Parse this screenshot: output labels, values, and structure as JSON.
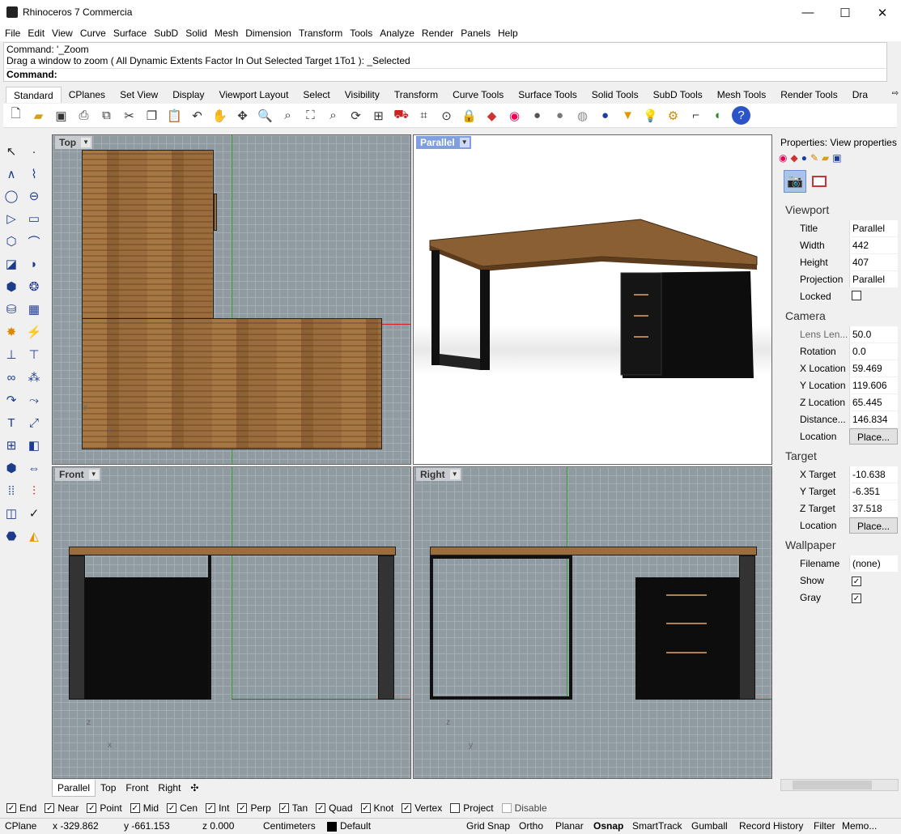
{
  "window": {
    "title": "Rhinoceros 7 Commercia"
  },
  "menu": [
    "File",
    "Edit",
    "View",
    "Curve",
    "Surface",
    "SubD",
    "Solid",
    "Mesh",
    "Dimension",
    "Transform",
    "Tools",
    "Analyze",
    "Render",
    "Panels",
    "Help"
  ],
  "command": {
    "history1": "Command: '_Zoom",
    "history2": "Drag a window to zoom ( All  Dynamic  Extents  Factor  In  Out  Selected  Target  1To1 ): _Selected",
    "prompt": "Command:"
  },
  "toolbar_tabs": [
    "Standard",
    "CPlanes",
    "Set View",
    "Display",
    "Viewport Layout",
    "Select",
    "Visibility",
    "Transform",
    "Curve Tools",
    "Surface Tools",
    "Solid Tools",
    "SubD Tools",
    "Mesh Tools",
    "Render Tools",
    "Dra"
  ],
  "toolbar_icons": [
    "new-icon",
    "open-icon",
    "save-icon",
    "print-icon",
    "import-icon",
    "cut-icon",
    "copy-icon",
    "paste-icon",
    "undo-icon",
    "pan-icon",
    "move-icon",
    "zoom-icon",
    "zoom-window-icon",
    "zoom-extents-icon",
    "zoom-selected-icon",
    "rotate-view-icon",
    "four-view-icon",
    "car-icon",
    "grid-icon",
    "circle-point-icon",
    "lock-icon",
    "layers-icon",
    "color-wheel-icon",
    "sphere-icon",
    "shaded-sphere-icon",
    "render-sphere-icon",
    "blue-sphere-icon",
    "light-icon",
    "bulb-icon",
    "gear-icon",
    "snap-icon",
    "globe-icon",
    "help-icon"
  ],
  "viewports": {
    "top": {
      "label": "Top"
    },
    "parallel": {
      "label": "Parallel"
    },
    "front": {
      "label": "Front"
    },
    "right": {
      "label": "Right"
    }
  },
  "axes": {
    "x": "x",
    "y": "y",
    "z": "z"
  },
  "viewport_tabs": [
    "Parallel",
    "Top",
    "Front",
    "Right"
  ],
  "properties": {
    "header": "Properties: View properties",
    "viewport_section": "Viewport",
    "title_label": "Title",
    "title_value": "Parallel",
    "width_label": "Width",
    "width_value": "442",
    "height_label": "Height",
    "height_value": "407",
    "projection_label": "Projection",
    "projection_value": "Parallel",
    "locked_label": "Locked",
    "camera_section": "Camera",
    "lens_label": "Lens Len...",
    "lens_value": "50.0",
    "rotation_label": "Rotation",
    "rotation_value": "0.0",
    "xloc_label": "X Location",
    "xloc_value": "59.469",
    "yloc_label": "Y Location",
    "yloc_value": "119.606",
    "zloc_label": "Z Location",
    "zloc_value": "65.445",
    "distance_label": "Distance...",
    "distance_value": "146.834",
    "cam_location_label": "Location",
    "cam_location_button": "Place...",
    "target_section": "Target",
    "xtarget_label": "X Target",
    "xtarget_value": "-10.638",
    "ytarget_label": "Y Target",
    "ytarget_value": "-6.351",
    "ztarget_label": "Z Target",
    "ztarget_value": "37.518",
    "tgt_location_label": "Location",
    "tgt_location_button": "Place...",
    "wallpaper_section": "Wallpaper",
    "filename_label": "Filename",
    "filename_value": "(none)",
    "show_label": "Show",
    "gray_label": "Gray"
  },
  "osnap": [
    {
      "label": "End",
      "checked": true
    },
    {
      "label": "Near",
      "checked": true
    },
    {
      "label": "Point",
      "checked": true
    },
    {
      "label": "Mid",
      "checked": true
    },
    {
      "label": "Cen",
      "checked": true
    },
    {
      "label": "Int",
      "checked": true
    },
    {
      "label": "Perp",
      "checked": true
    },
    {
      "label": "Tan",
      "checked": true
    },
    {
      "label": "Quad",
      "checked": true
    },
    {
      "label": "Knot",
      "checked": true
    },
    {
      "label": "Vertex",
      "checked": true
    },
    {
      "label": "Project",
      "checked": false
    },
    {
      "label": "Disable",
      "checked": false
    }
  ],
  "status": {
    "cplane": "CPlane",
    "x": "x -329.862",
    "y": "y -661.153",
    "z": "z 0.000",
    "units": "Centimeters",
    "layer": "Default",
    "grid_snap": "Grid Snap",
    "ortho": "Ortho",
    "planar": "Planar",
    "osnap": "Osnap",
    "smarttrack": "SmartTrack",
    "gumball": "Gumball",
    "record_history": "Record History",
    "filter": "Filter",
    "memo": "Memo..."
  }
}
